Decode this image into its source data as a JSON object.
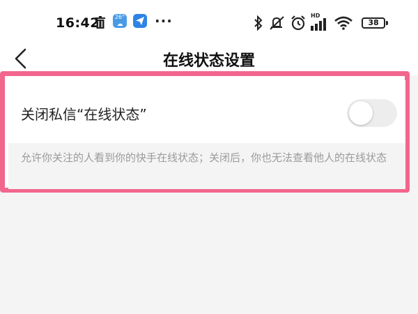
{
  "status_bar": {
    "time": "16:42",
    "weather_temp": "26°",
    "more": "···",
    "battery": "38",
    "network_label": "HD"
  },
  "header": {
    "title": "在线状态设置"
  },
  "setting": {
    "label": "关闭私信“在线状态”",
    "toggle_on": false,
    "description": "允许你关注的人看到你的快手在线状态；关闭后，你也无法查看他人的在线状态"
  },
  "colors": {
    "highlight_border": "#f2668e",
    "toggle_off": "#ededed",
    "background": "#f4f4f4"
  }
}
